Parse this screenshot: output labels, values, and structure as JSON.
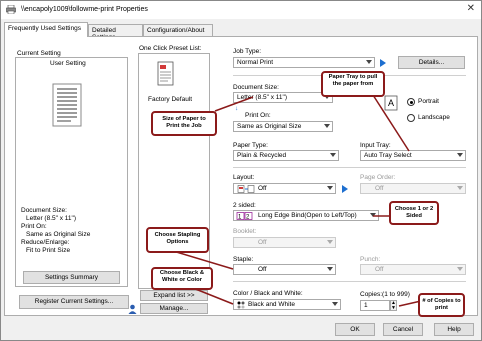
{
  "window": {
    "title": "\\\\encapoly1009\\followme-print Properties"
  },
  "tabs": [
    {
      "label": "Frequently Used Settings"
    },
    {
      "label": "Detailed Settings"
    },
    {
      "label": "Configuration/About"
    }
  ],
  "current_setting": {
    "heading": "Current Setting",
    "subheading": "User Setting",
    "doc_size_label": "Document Size:",
    "doc_size_value": "Letter (8.5\" x 11\")",
    "print_on_label": "Print On:",
    "print_on_value": "Same as Original Size",
    "reduce_label": "Reduce/Enlarge:",
    "reduce_value": "Fit to Print Size",
    "summary_button": "Settings Summary"
  },
  "preset": {
    "heading": "One Click Preset List:",
    "item_label": "Factory Default",
    "expand_button": "Expand list >>",
    "manage_button": "Manage...",
    "register_button": "Register Current Settings..."
  },
  "form": {
    "job_type_label": "Job Type:",
    "job_type_value": "Normal Print",
    "details_button": "Details...",
    "document_size_label": "Document Size:",
    "document_size_value": "Letter (8.5\" x 11\")",
    "print_on_label": "Print On:",
    "print_on_value": "Same as Original Size",
    "orientation_label_partial": "ation",
    "portrait_label": "Portrait",
    "landscape_label": "Landscape",
    "paper_type_label": "Paper Type:",
    "paper_type_value": "Plain & Recycled",
    "input_tray_label": "Input Tray:",
    "input_tray_value": "Auto Tray Select",
    "layout_label": "Layout:",
    "layout_value": "Off",
    "page_order_label": "Page Order:",
    "page_order_value": "Off",
    "two_sided_label": "2 sided:",
    "two_sided_value": "Long Edge Bind(Open to Left/Top)",
    "booklet_label": "Booklet:",
    "booklet_value": "Off",
    "staple_label": "Staple:",
    "staple_value": "Off",
    "punch_label": "Punch:",
    "punch_value": "Off",
    "color_label": "Color / Black and White:",
    "color_value": "Black and White",
    "copies_label": "Copies:(1 to 999)",
    "copies_value": "1"
  },
  "dialog_buttons": {
    "ok": "OK",
    "cancel": "Cancel",
    "help": "Help"
  },
  "callouts": {
    "paper_tray": "Paper Tray to pull the paper from",
    "size_of_paper": "Size of Paper to Print the Job",
    "two_sided": "Choose 1 or 2 Sided",
    "stapling": "Choose Stapling Options",
    "color": "Choose Black & White or Color",
    "copies": "# of Copies to print"
  },
  "colors": {
    "callout_border": "#8b1a1a",
    "accent": "#1e6fd0"
  }
}
